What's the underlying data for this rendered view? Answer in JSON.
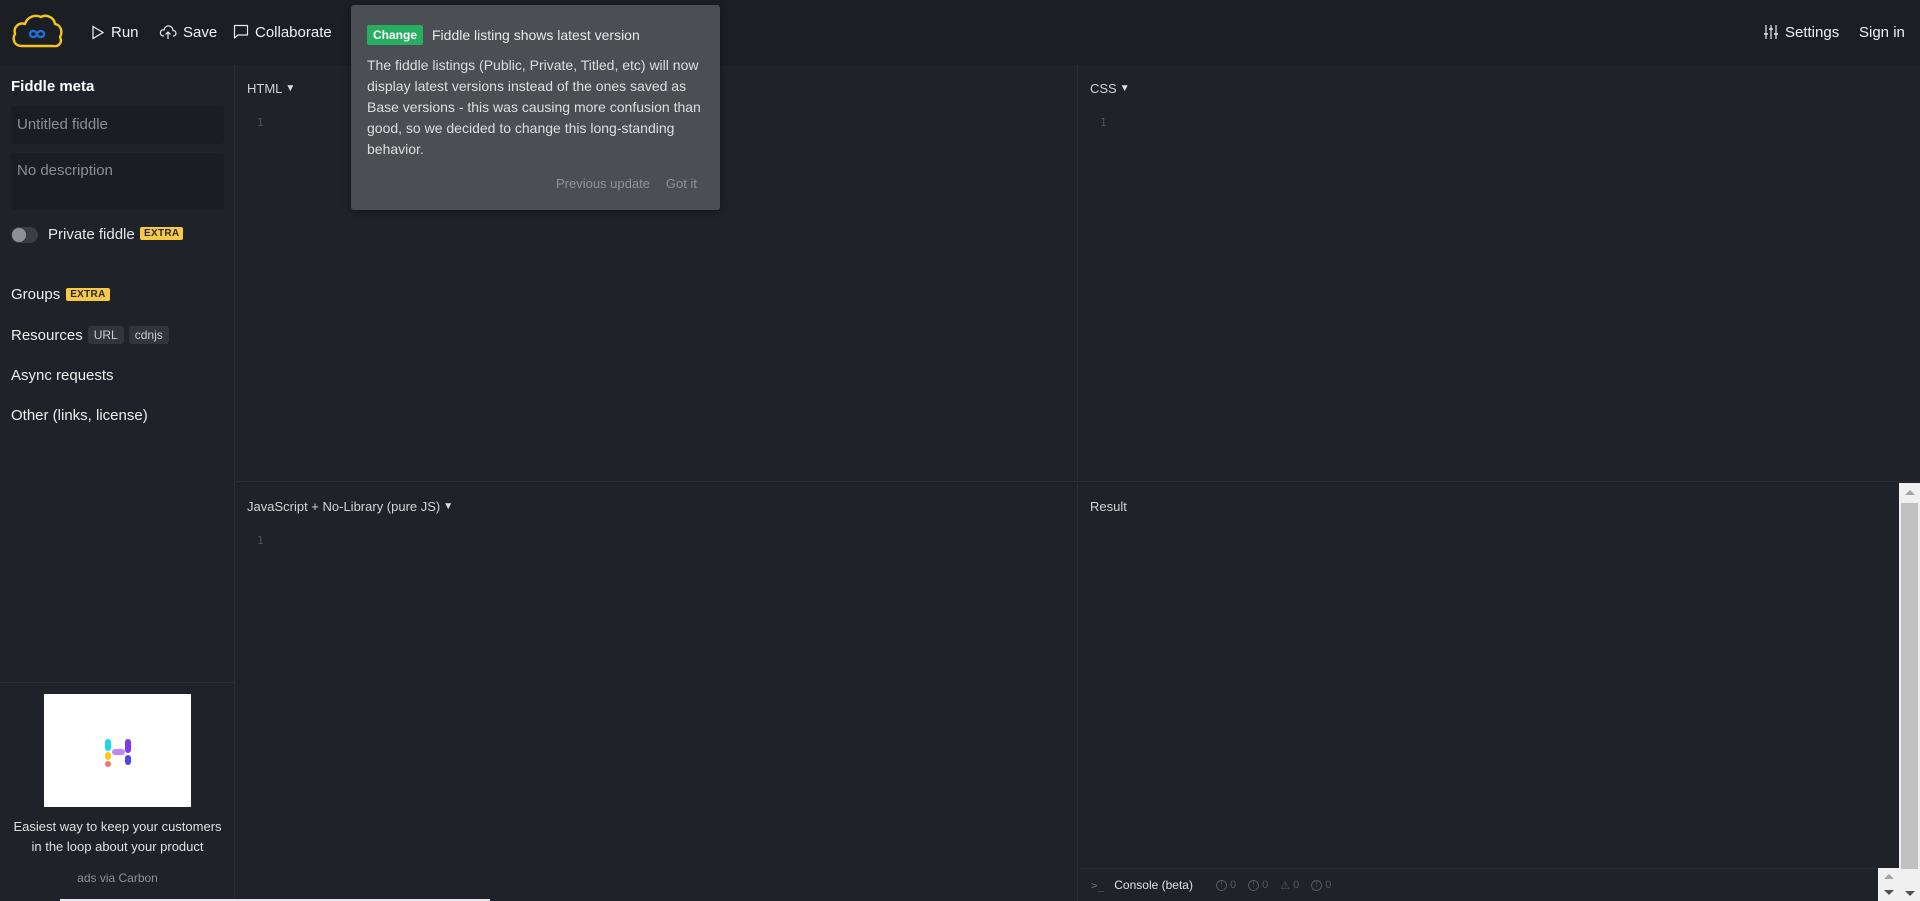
{
  "topbar": {
    "run_label": "Run",
    "save_label": "Save",
    "collaborate_label": "Collaborate",
    "settings_label": "Settings",
    "signin_label": "Sign in",
    "logo_icon": "cloud-infinity-logo"
  },
  "sidebar": {
    "title": "Fiddle meta",
    "title_placeholder": "Untitled fiddle",
    "description_placeholder": "No description",
    "private_label": "Private fiddle",
    "private_enabled": false,
    "extra_badge": "EXTRA",
    "sections": {
      "groups": "Groups",
      "resources": "Resources",
      "resources_tags": [
        "URL",
        "cdnjs"
      ],
      "async": "Async requests",
      "other": "Other (links, license)"
    },
    "ad": {
      "text": "Easiest way to keep your customers in the loop about your product",
      "via": "ads via Carbon"
    }
  },
  "panels": {
    "html": {
      "label": "HTML",
      "line": "1"
    },
    "css": {
      "label": "CSS",
      "line": "1"
    },
    "js": {
      "label": "JavaScript + No-Library (pure JS)",
      "line": "1"
    },
    "result": {
      "label": "Result"
    }
  },
  "console": {
    "label": "Console (beta)",
    "counts": [
      "0",
      "0",
      "0",
      "0"
    ]
  },
  "popup": {
    "badge": "Change",
    "title": "Fiddle listing shows latest version",
    "body": "The fiddle listings (Public, Private, Titled, etc) will now display latest versions instead of the ones saved as Base versions - this was causing more confusion than good, so we decided to change this long-standing behavior.",
    "previous_label": "Previous update",
    "got_it_label": "Got it"
  },
  "colors": {
    "accent_change": "#27ae60",
    "extra_badge": "#f7c948",
    "logo_cloud": "#f5c518",
    "logo_infinity": "#1e6fd9"
  }
}
